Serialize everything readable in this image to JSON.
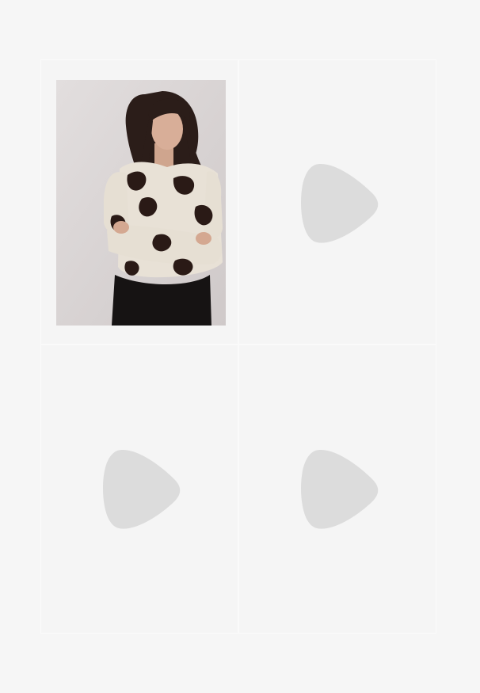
{
  "grid": {
    "items": [
      {
        "type": "image",
        "icon": "product-photo"
      },
      {
        "type": "video-placeholder",
        "icon": "play-icon"
      },
      {
        "type": "video-placeholder",
        "icon": "play-icon"
      },
      {
        "type": "video-placeholder",
        "icon": "play-icon"
      }
    ]
  },
  "colors": {
    "background": "#f6f6f6",
    "placeholder_icon": "#dcdcdc"
  }
}
